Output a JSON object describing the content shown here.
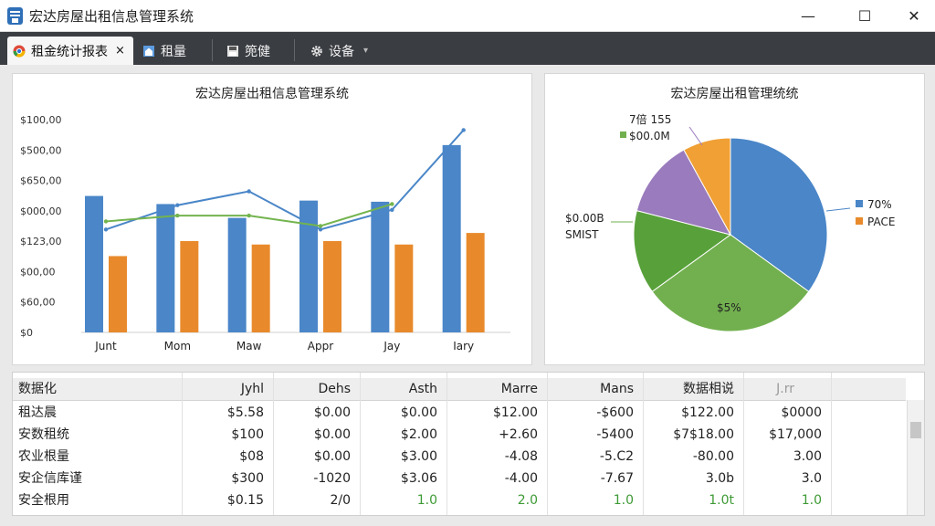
{
  "window": {
    "title": "宏达房屋出租信息管理系统",
    "min": "—",
    "max": "☐",
    "close": "✕"
  },
  "tabs": [
    {
      "label": "租金统计报表",
      "icon": "chrome-icon",
      "close": "×"
    },
    {
      "label": "租量",
      "icon": "house-icon"
    },
    {
      "label": "篼健",
      "icon": "save-icon"
    },
    {
      "label": "设备",
      "icon": "gear-icon",
      "arrow": "▾"
    }
  ],
  "bar_chart": {
    "chart_data": {
      "type": "bar",
      "title": "宏达房屋出租信息管理系统",
      "categories": [
        "Junt",
        "Mom",
        "Maw",
        "Appr",
        "Jay",
        "Iary"
      ],
      "series": [
        {
          "color": "#4a86c8",
          "values": [
            590,
            555,
            495,
            570,
            565,
            810
          ]
        },
        {
          "color": "#e88a2c",
          "values": [
            330,
            395,
            380,
            395,
            380,
            430
          ]
        }
      ],
      "line_series": [
        {
          "color": "#4a86c8",
          "values": [
            445,
            550,
            610,
            445,
            530,
            875
          ]
        },
        {
          "color": "#73b44e",
          "values": [
            480,
            505,
            505,
            460,
            555,
            0
          ]
        }
      ],
      "y_tick_labels": [
        "$100,00",
        "$500,00",
        "$650,00",
        "$000,00",
        "$123,00",
        "$00,00",
        "$60,00",
        "$0"
      ],
      "ylim": [
        0,
        920
      ]
    }
  },
  "pie_chart": {
    "chart_data": {
      "type": "pie",
      "title": "宏达房屋出租管理统统",
      "slices": [
        {
          "value": 35,
          "color": "#4a86c8"
        },
        {
          "value": 30,
          "color": "#72b04f"
        },
        {
          "value": 14,
          "color": "#58a13a"
        },
        {
          "value": 13,
          "color": "#9a7bbd"
        },
        {
          "value": 8,
          "color": "#f0a034"
        }
      ],
      "labels": {
        "inside": "$5%",
        "top1": "7倍 155",
        "top2": "$00.0M",
        "left1": "$0.00B",
        "left2": "SMIST",
        "legend1": "70%",
        "legend2": "PACE"
      },
      "legend_colors": [
        "#4a86c8",
        "#e88a2c"
      ]
    }
  },
  "table": {
    "headers": [
      "数据化",
      "Jyhl",
      "Dehs",
      "Asth",
      "Marre",
      "Mans",
      "数据相说",
      "J.rr"
    ],
    "rows": [
      [
        "租达晨",
        "$5.58",
        "$0.00",
        "$0.00",
        "$12.00",
        "-$600",
        "$122.00",
        "$0000"
      ],
      [
        "安数租统",
        "$100",
        "$0.00",
        "$2.00",
        "+2.60",
        "-5400",
        "$7$18.00",
        "$17,000"
      ],
      [
        "农业根量",
        "$08",
        "$0.00",
        "$3.00",
        "-4.08",
        "-5.C2",
        "-80.00",
        "3.00"
      ],
      [
        "安企信库谨",
        "$300",
        "-1020",
        "$3.06",
        "-4.00",
        "-7.67",
        "3.0b",
        "3.0"
      ],
      [
        "安全根用",
        "$0.15",
        "2/0",
        "1.0",
        "2.0",
        "1.0",
        "1.0t",
        "1.0"
      ]
    ],
    "green": "#3d9a34"
  }
}
